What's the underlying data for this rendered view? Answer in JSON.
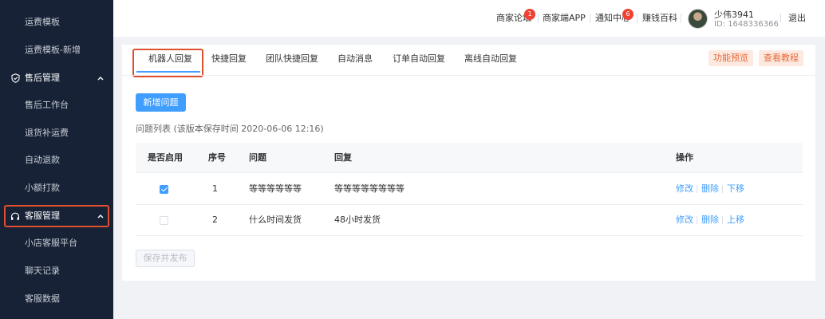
{
  "sidebar": {
    "items": [
      {
        "label": "运费模板"
      },
      {
        "label": "运费模板-新增"
      },
      {
        "label": "售后管理"
      },
      {
        "label": "售后工作台"
      },
      {
        "label": "退货补运费"
      },
      {
        "label": "自动退款"
      },
      {
        "label": "小额打款"
      },
      {
        "label": "客服管理"
      },
      {
        "label": "小店客服平台"
      },
      {
        "label": "聊天记录"
      },
      {
        "label": "客服数据"
      }
    ]
  },
  "header": {
    "links": [
      {
        "label": "商家论坛",
        "badge": "1"
      },
      {
        "label": "商家端APP"
      },
      {
        "label": "通知中心",
        "badge": "6"
      },
      {
        "label": "赚钱百科"
      }
    ],
    "user": {
      "name": "少伟3941",
      "id": "ID: 1648336366"
    },
    "logout": "退出"
  },
  "tabs": [
    {
      "label": "机器人回复"
    },
    {
      "label": "快捷回复"
    },
    {
      "label": "团队快捷回复"
    },
    {
      "label": "自动消息"
    },
    {
      "label": "订单自动回复"
    },
    {
      "label": "离线自动回复"
    }
  ],
  "actions": {
    "preview": "功能预览",
    "tutorial": "查看教程"
  },
  "main": {
    "add_button": "新增问题",
    "list_title": "问题列表 (该版本保存时间 2020-06-06 12:16)",
    "save_button": "保存并发布"
  },
  "table": {
    "headers": [
      "是否启用",
      "序号",
      "问题",
      "回复",
      "操作"
    ],
    "rows": [
      {
        "enabled": true,
        "index": "1",
        "question": "等等等等等等",
        "reply": "等等等等等等等等",
        "ops": [
          "修改",
          "删除",
          "下移"
        ]
      },
      {
        "enabled": false,
        "index": "2",
        "question": "什么时间发货",
        "reply": "48小时发货",
        "ops": [
          "修改",
          "删除",
          "上移"
        ]
      }
    ]
  },
  "colors": {
    "sidebar_bg": "#172237",
    "primary": "#409eff",
    "highlight": "#e0502e",
    "badge": "#f04134"
  }
}
